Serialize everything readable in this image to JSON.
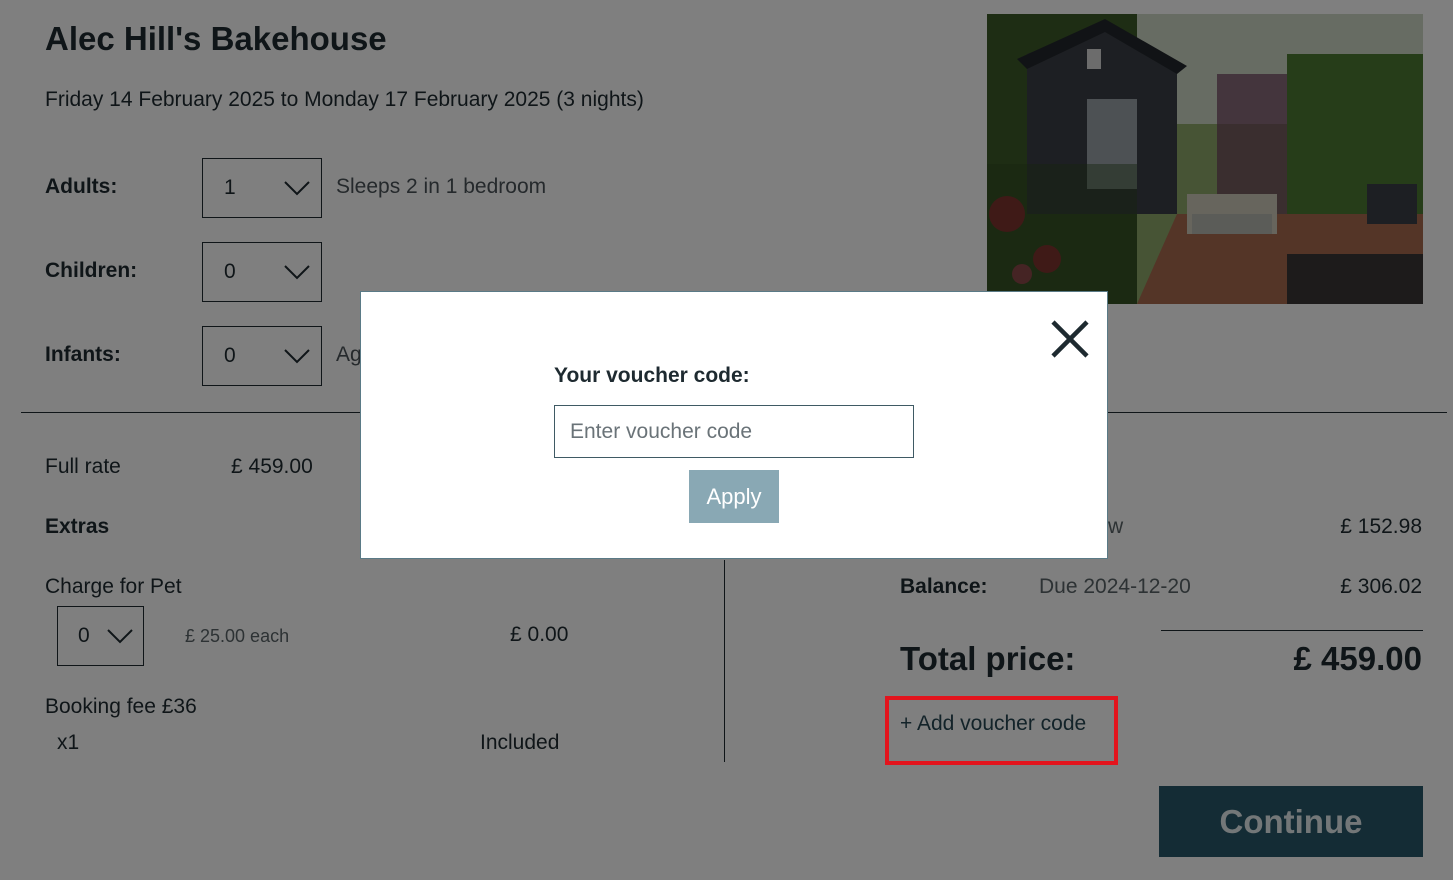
{
  "property": {
    "title": "Alec Hill's Bakehouse",
    "dates": "Friday 14 February 2025 to Monday 17 February 2025 (3 nights)"
  },
  "party": {
    "adults": {
      "label": "Adults:",
      "value": "1",
      "note": "Sleeps 2 in 1 bedroom"
    },
    "children": {
      "label": "Children:",
      "value": "0"
    },
    "infants": {
      "label": "Infants:",
      "value": "0",
      "note": "Ag"
    }
  },
  "pricing": {
    "full_rate_label": "Full rate",
    "full_rate_value": "£ 459.00",
    "extras_label": "Extras",
    "pet": {
      "label": "Charge for Pet",
      "qty": "0",
      "unit": "£ 25.00 each",
      "total": "£ 0.00"
    },
    "booking_fee": {
      "label": "Booking fee £36",
      "qty": "x1",
      "status": "Included"
    }
  },
  "summary": {
    "deposit_fragment": "w",
    "deposit_value": "£ 152.98",
    "balance_label": "Balance:",
    "balance_due": "Due 2024-12-20",
    "balance_value": "£ 306.02",
    "total_label": "Total price:",
    "total_value": "£ 459.00",
    "voucher_link": "+ Add voucher code",
    "continue_label": "Continue"
  },
  "modal": {
    "label": "Your voucher code:",
    "placeholder": "Enter voucher code",
    "apply_label": "Apply"
  },
  "colors": {
    "highlight": "#e3141d",
    "continue_bg": "#29596a",
    "apply_bg": "#89a8b4"
  }
}
